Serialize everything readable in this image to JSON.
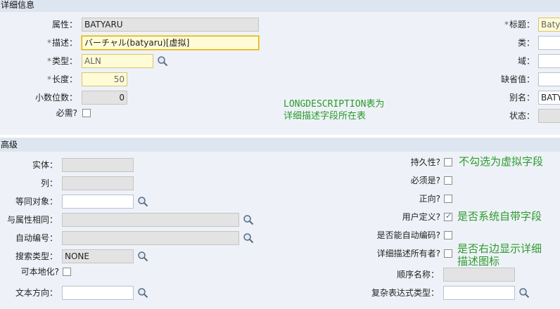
{
  "sections": {
    "details": "详细信息",
    "advanced": "高级"
  },
  "left": {
    "attribute_label": "属性：",
    "attribute_value": "BATYARU",
    "description_label": "描述：",
    "description_value": "バーチャル(batyaru)[虚拟]",
    "type_label": "类型：",
    "type_value": "ALN",
    "length_label": "长度：",
    "length_value": "50",
    "scale_label": "小数位数：",
    "scale_value": "0",
    "required_label": "必需?"
  },
  "right": {
    "title_label": "标题：",
    "title_value": "Batya",
    "class_label": "类：",
    "domain_label": "域：",
    "default_label": "缺省值：",
    "alias_label": "别名：",
    "alias_value": "BATY",
    "status_label": "状态："
  },
  "advanced": {
    "entity_label": "实体：",
    "column_label": "列：",
    "sameas_object_label": "等同对象：",
    "sameas_attribute_label": "与属性相同：",
    "autokey_label": "自动编号：",
    "search_type_label": "搜索类型：",
    "search_type_value": "NONE",
    "localizable_label": "可本地化?",
    "text_direction_label": "文本方向：",
    "persistent_label": "持久性?",
    "mustbe_label": "必须是?",
    "positive_label": "正向?",
    "userdefined_label": "用户定义?",
    "can_autonum_label": "是否能自动编码?",
    "ld_owner_label": "详细描述所有者?",
    "sequence_label": "顺序名称：",
    "complex_type_label": "复杂表达式类型："
  },
  "checkboxes": {
    "required": false,
    "localizable": false,
    "persistent": false,
    "mustbe": false,
    "positive": false,
    "userdefined": true,
    "can_autonum": false,
    "ld_owner": false
  },
  "annotations": {
    "longdesc_line1": "LONGDESCRIPTION表为",
    "longdesc_line2": "详细描述字段所在表",
    "persistent_note": "不勾选为虚拟字段",
    "userdefined_note": "是否系统自带字段",
    "ld_owner_note_line1": "是否右边显示详细",
    "ld_owner_note_line2": "描述图标"
  },
  "colors": {
    "section_header": "#dde6f0",
    "section_bg": "#eef2f8",
    "required_field": "#fffbd6",
    "readonly_field": "#e3e3e3",
    "annotation": "#2e9a2e"
  },
  "icons": {
    "lookup": "magnifier-icon",
    "required_marker": "asterisk-icon"
  }
}
